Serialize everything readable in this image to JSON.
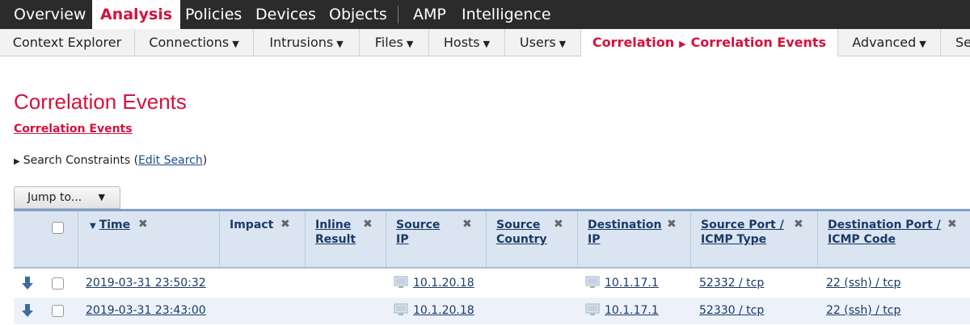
{
  "topnav": {
    "items": [
      "Overview",
      "Analysis",
      "Policies",
      "Devices",
      "Objects",
      "AMP",
      "Intelligence"
    ]
  },
  "subnav": {
    "items": [
      "Context Explorer",
      "Connections",
      "Intrusions",
      "Files",
      "Hosts",
      "Users",
      "Advanced",
      "Se"
    ],
    "active_path_1": "Correlation",
    "active_path_2": "Correlation Events"
  },
  "page": {
    "title": "Correlation Events",
    "workflow_link": "Correlation Events"
  },
  "search": {
    "label": "Search Constraints (",
    "edit_link": "Edit Search",
    "close_paren": ")"
  },
  "jump": {
    "label": "Jump to..."
  },
  "table": {
    "headers": {
      "time": "Time",
      "impact": "Impact",
      "inline_1": "Inline",
      "inline_2": "Result",
      "src_ip_1": "Source",
      "src_ip_2": "IP",
      "src_country_1": "Source",
      "src_country_2": "Country",
      "dst_ip_1": "Destination",
      "dst_ip_2": "IP",
      "src_port_1": "Source Port /",
      "src_port_2": "ICMP Type",
      "dst_port_1": "Destination Port /",
      "dst_port_2": "ICMP Code"
    },
    "rows": [
      {
        "time": "2019-03-31 23:50:32",
        "src_ip": "10.1.20.18",
        "dst_ip": "10.1.17.1",
        "src_port": "52332 / tcp",
        "dst_port": "22 (ssh) / tcp"
      },
      {
        "time": "2019-03-31 23:43:00",
        "src_ip": "10.1.20.18",
        "dst_ip": "10.1.17.1",
        "src_port": "52330 / tcp",
        "dst_port": "22 (ssh) / tcp"
      }
    ]
  },
  "colors": {
    "accent": "#d4123d",
    "nav_bg": "#2b2b2b",
    "header_bg": "#dbe5f1",
    "link": "#1a3a66"
  }
}
